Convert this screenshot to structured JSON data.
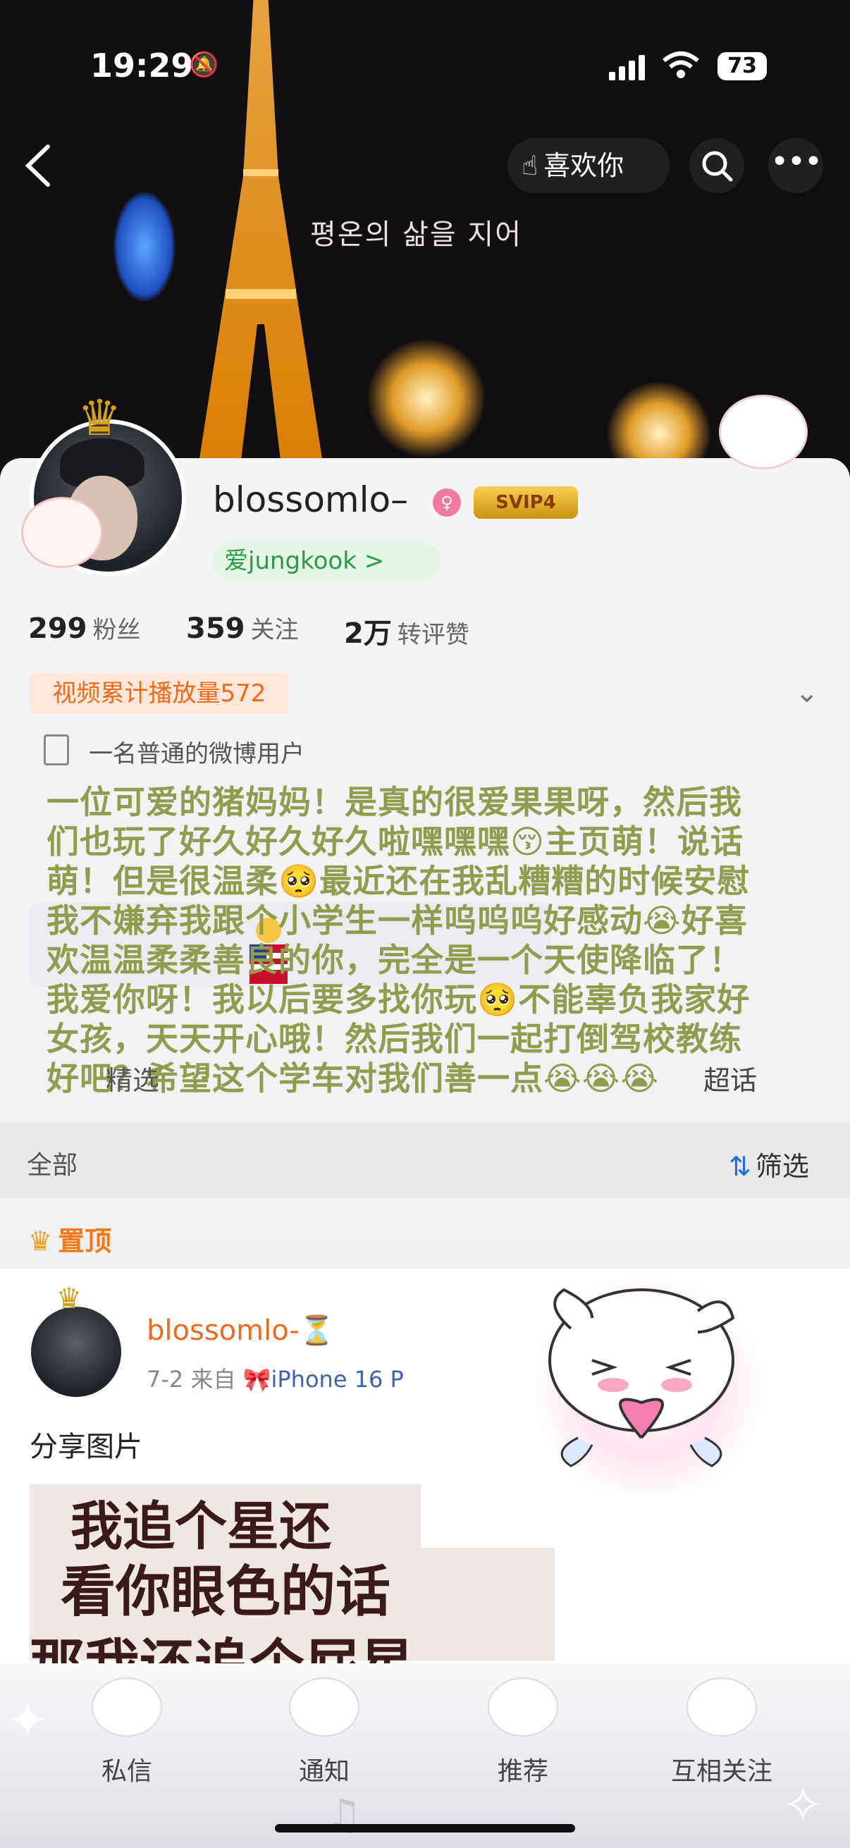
{
  "status_bar": {
    "time": "19:29",
    "battery": "73"
  },
  "header": {
    "like_label": "喜欢你",
    "photo_caption": "평온의 삶을 지어"
  },
  "profile": {
    "username": "blossomlo–",
    "vip_badge": "SVIP4",
    "fan_badge": "爱jungkook >",
    "stats": [
      {
        "value": "299",
        "label": "粉丝"
      },
      {
        "value": "359",
        "label": "关注"
      },
      {
        "value": "2万",
        "label": "转评赞"
      }
    ],
    "video_plays": "视频累计播放量572",
    "bio": "一名普通的微博用户"
  },
  "overlay_comment": "一位可爱的猪妈妈！是真的很爱果果呀，然后我们也玩了好久好久好久啦嘿嘿嘿😚主页萌！说话萌！但是很温柔🥺最近还在我乱糟糟的时候安慰我不嫌弃我跟个小学生一样呜呜呜好感动😭好喜欢温温柔柔善良的你，完全是一个天使降临了！我爱你呀！我以后要多找你玩🥺不能辜负我家好女孩，天天开心哦！然后我们一起打倒驾校教练好吧？希望这个学车对我们善一点😭😭😭",
  "tabs": {
    "visible_left": "精选",
    "chaohua": "超话"
  },
  "filter_bar": {
    "all_label": "全部",
    "filter_label": "筛选"
  },
  "feed": {
    "pinned_label": "置顶",
    "post": {
      "author": "blossomlo-⏳",
      "date": "7-2",
      "source_prefix": "来自",
      "device": "iPhone 16 P",
      "text": "分享图片",
      "image_lines": [
        "我追个星还",
        "看你眼色的话",
        "那我还追个屁星"
      ]
    }
  },
  "tabbar": {
    "items": [
      {
        "label": "私信"
      },
      {
        "label": "通知"
      },
      {
        "label": "推荐"
      },
      {
        "label": "互相关注"
      }
    ]
  },
  "colors": {
    "accent_orange": "#ee6a1e",
    "overlay_text": "#8f9d4e",
    "fan_badge_green": "#2b9b47",
    "link_blue": "#1d6fe0"
  }
}
